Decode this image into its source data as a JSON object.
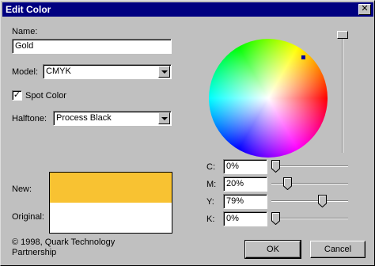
{
  "window": {
    "title": "Edit Color",
    "close_glyph": "✕"
  },
  "name": {
    "label": "Name:",
    "value": "Gold"
  },
  "model": {
    "label": "Model:",
    "value": "CMYK"
  },
  "spot_color": {
    "label": "Spot Color",
    "checked": true,
    "check_glyph": "✓"
  },
  "halftone": {
    "label": "Halftone:",
    "value": "Process Black"
  },
  "swatches": {
    "new_label": "New:",
    "original_label": "Original:",
    "new_color": "#f8c232",
    "original_color": "#ffffff"
  },
  "copyright": "© 1998, Quark Technology Partnership",
  "cmyk": [
    {
      "label": "C:",
      "value": "0%",
      "level": 0.0
    },
    {
      "label": "M:",
      "value": "20%",
      "level": 0.2
    },
    {
      "label": "Y:",
      "value": "79%",
      "level": 0.79
    },
    {
      "label": "K:",
      "value": "0%",
      "level": 0.0
    }
  ],
  "brightness_level": 1.0,
  "buttons": {
    "ok": "OK",
    "cancel": "Cancel"
  }
}
